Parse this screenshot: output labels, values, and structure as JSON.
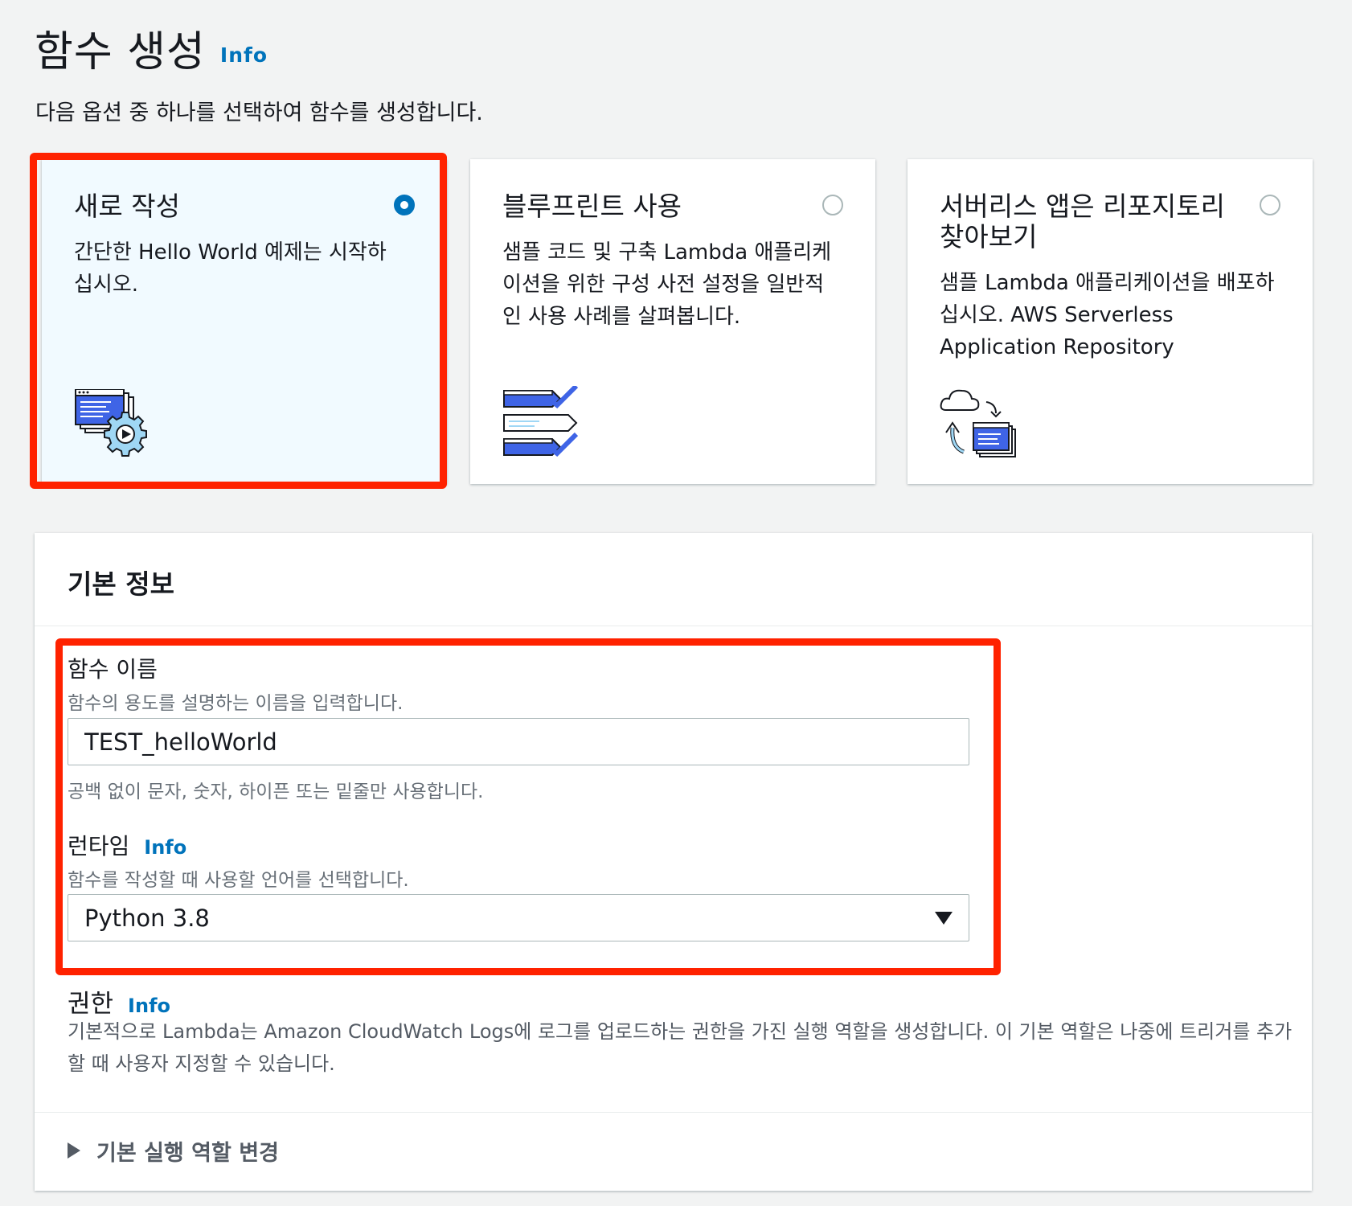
{
  "header": {
    "title": "함수 생성",
    "info_label": "Info",
    "description": "다음 옵션 중 하나를 선택하여 함수를 생성합니다."
  },
  "options": [
    {
      "title": "새로 작성",
      "description": "간단한 Hello World 예제는 시작하십시오.",
      "selected": true,
      "icon": "code-gear-icon"
    },
    {
      "title": "블루프린트 사용",
      "description": "샘플 코드 및 구축 Lambda 애플리케이션을 위한 구성 사전 설정을 일반적인 사용 사례를 살펴봅니다.",
      "selected": false,
      "icon": "checklist-icon"
    },
    {
      "title": "서버리스 앱은 리포지토리 찾아보기",
      "description": "샘플 Lambda 애플리케이션을 배포하십시오. AWS Serverless Application Repository",
      "selected": false,
      "icon": "cloud-deploy-icon"
    }
  ],
  "basic_info": {
    "title": "기본 정보",
    "function_name": {
      "label": "함수 이름",
      "description": "함수의 용도를 설명하는 이름을 입력합니다.",
      "value": "TEST_helloWorld",
      "hint": "공백 없이 문자, 숫자, 하이픈 또는 밑줄만 사용합니다."
    },
    "runtime": {
      "label": "런타임",
      "info_label": "Info",
      "description": "함수를 작성할 때 사용할 언어를 선택합니다.",
      "value": "Python 3.8"
    },
    "permissions": {
      "label": "권한",
      "info_label": "Info",
      "description": "기본적으로 Lambda는 Amazon CloudWatch Logs에 로그를 업로드하는 권한을 가진 실행 역할을 생성합니다. 이 기본 역할은 나중에 트리거를 추가할 때 사용자 지정할 수 있습니다."
    },
    "expander_label": "기본 실행 역할 변경"
  },
  "colors": {
    "accent": "#0073bb",
    "highlight": "#ff2200",
    "selected_card_bg": "#f1faff"
  }
}
